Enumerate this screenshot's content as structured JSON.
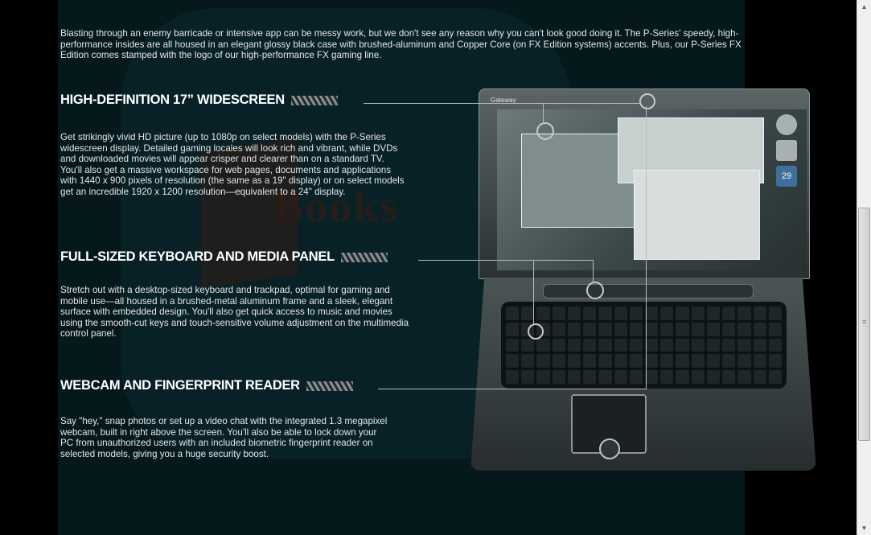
{
  "intro": {
    "text": "Blasting through an enemy barricade or intensive app can be messy work, but we don't see any reason why you can't look good doing it. The P-Series' speedy, high-performance insides are all housed in an elegant glossy black case with brushed-aluminum and Copper Core (on FX Edition systems) accents. Plus, our P-Series FX Edition comes stamped with the logo of our high-performance FX gaming line."
  },
  "sections": [
    {
      "heading": "HIGH-DEFINITION 17” WIDESCREEN",
      "body": "Get strikingly vivid HD picture (up to 1080p on select models) with the P-Series widescreen display. Detailed gaming locales will look rich and vibrant, while DVDs and downloaded movies will appear crisper and clearer than on a standard TV. You'll also get a massive workspace for web pages, documents and applications with 1440 x 900 pixels of resolution (the same as a 19\" display) or on select models get an incredible 1920 x 1200 resolution—equivalent to a 24\" display."
    },
    {
      "heading": "FULL-SIZED KEYBOARD AND MEDIA PANEL",
      "body": "Stretch out with a desktop-sized keyboard and trackpad, optimal for gaming and mobile use—all housed in a brushed-metal aluminum frame and a sleek, elegant surface with embedded design. You'll also get quick access to music and movies using the smooth-cut keys and touch-sensitive volume adjustment on the multimedia control panel."
    },
    {
      "heading": "WEBCAM AND FINGERPRINT READER",
      "body": "Say \"hey,\" snap photos or set up a video chat with the integrated 1.3 megapixel webcam, built in right above the screen. You'll also be able to lock down your PC from unauthorized users with an included biometric fingerprint reader on selected models, giving you a huge security boost."
    }
  ],
  "laptop": {
    "brand": "Gateway",
    "screen_date": "29"
  },
  "watermark": {
    "text": "Books"
  },
  "scrollbar": {
    "up_icon": "▲",
    "down_icon": "▼",
    "grip_icon": "≡"
  }
}
